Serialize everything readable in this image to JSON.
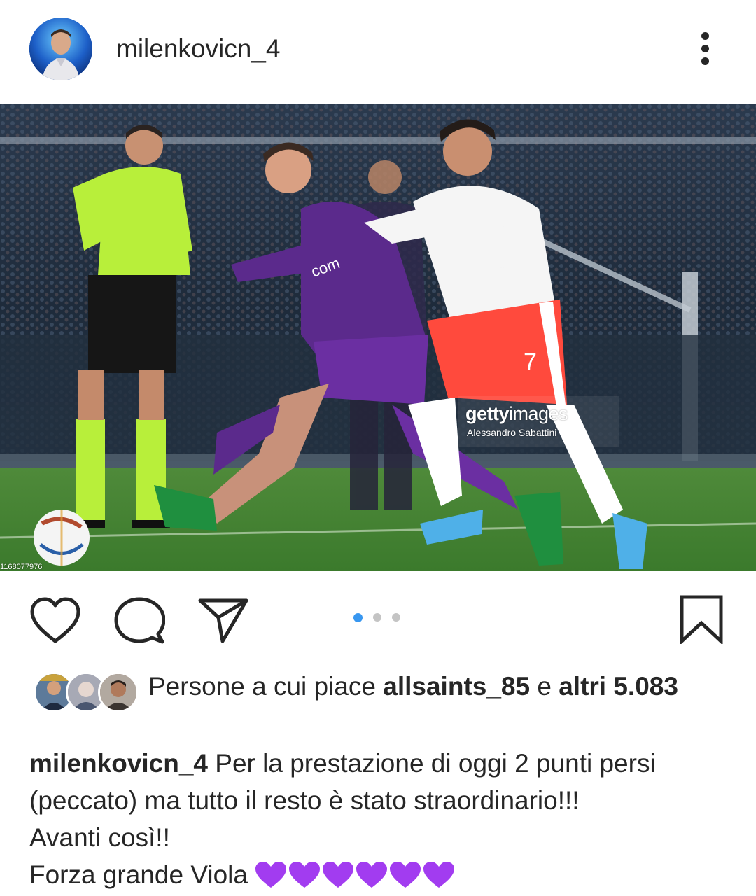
{
  "post": {
    "username": "milenkovicn_4",
    "photo": {
      "watermark_brand_bold": "getty",
      "watermark_brand_thin": "images",
      "watermark_credit": "Alessandro Sabattini",
      "image_id": "1168077976",
      "carousel": {
        "total": 3,
        "current": 1
      }
    }
  },
  "colors": {
    "text": "#262626",
    "carousel_active": "#3897f0",
    "carousel_inactive": "#c4c4c4",
    "fiorentina_purple": "#5b2a8c",
    "juventus_white": "#f5f5f5",
    "juventus_shorts": "#ff4a3d",
    "referee_green": "#b8ef3a",
    "heart_purple": "#a23cf0"
  },
  "actions": {
    "like_icon": "heart-outline-icon",
    "comment_icon": "comment-bubble-icon",
    "share_icon": "paper-plane-icon",
    "save_icon": "bookmark-icon"
  },
  "likes": {
    "prefix": "Persone a cui piace",
    "liker_username": "allsaints_85",
    "conjunction": "e",
    "others_label": "altri",
    "others_count": "5.083"
  },
  "caption": {
    "username": "milenkovicn_4",
    "line1": "Per la prestazione di oggi 2 punti persi (peccato) ma tutto il resto è stato straordinario!!!",
    "line2": "Avanti così!!",
    "line3": "Forza grande Viola",
    "emoji": "purple-heart",
    "emoji_count": 6
  }
}
